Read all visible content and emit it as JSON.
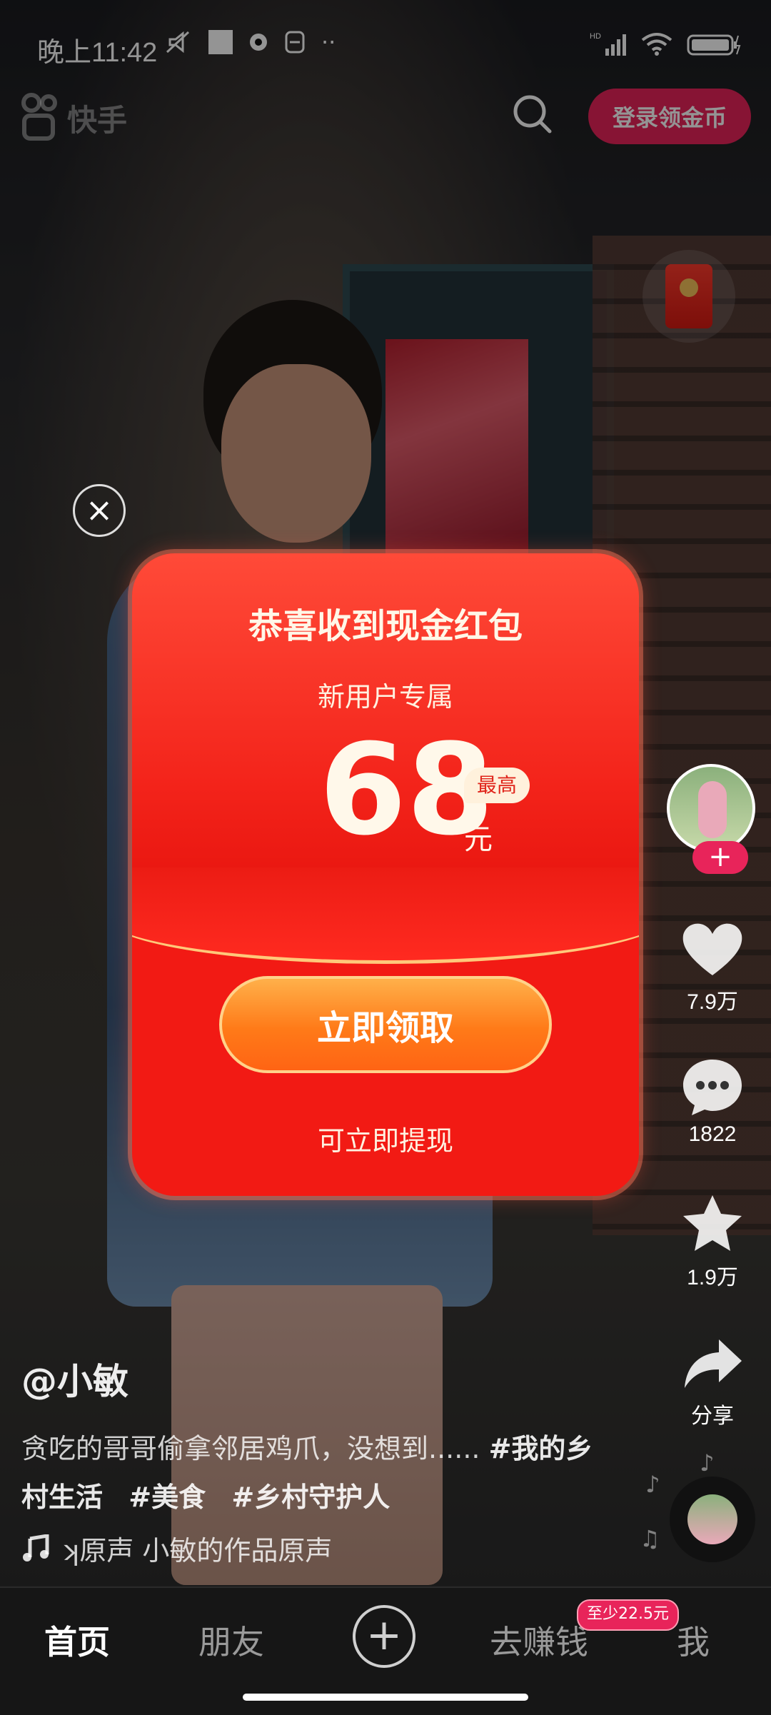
{
  "status_bar": {
    "time": "晚上11:42",
    "more": "··"
  },
  "header": {
    "app_name": "快手",
    "login_button": "登录领金币"
  },
  "popup": {
    "title": "恭喜收到现金红包",
    "subtitle": "新用户专属",
    "amount": "68",
    "amount_tag": "最高",
    "unit": "元",
    "claim_button": "立即领取",
    "footer": "可立即提现"
  },
  "sidebar": {
    "like_count": "7.9万",
    "comment_count": "1822",
    "favorite_count": "1.9万",
    "share_label": "分享"
  },
  "video_info": {
    "author": "@小敏",
    "description": "贪吃的哥哥偷拿邻居鸡爪，没想到......",
    "hashtags": [
      "#我的乡村生活",
      "#美食",
      "#乡村守护人"
    ],
    "music": "ʞ原声    小敏的作品原声"
  },
  "tabbar": {
    "home": "首页",
    "friends": "朋友",
    "earn": "去赚钱",
    "earn_badge": "至少22.5元",
    "me": "我"
  },
  "colors": {
    "accent": "#e8245a",
    "packet_red": "#f21a14",
    "button_orange": "#ff7a18"
  }
}
